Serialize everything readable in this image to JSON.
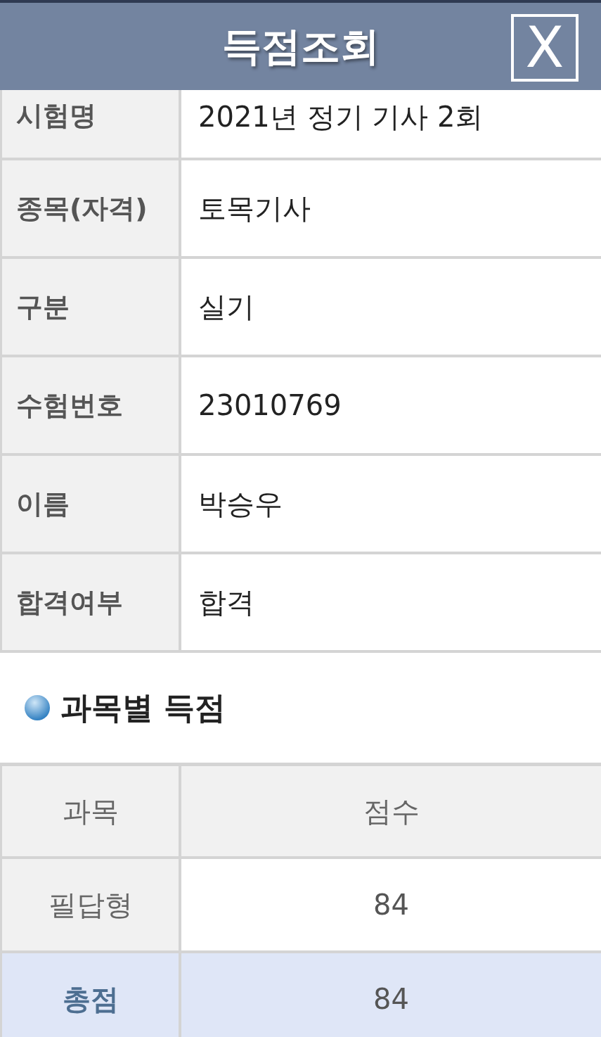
{
  "header": {
    "title": "득점조회",
    "close_label": "X"
  },
  "info_rows": [
    {
      "label": "시험명",
      "value": "2021년 정기 기사 2회"
    },
    {
      "label": "종목(자격)",
      "value": "토목기사"
    },
    {
      "label": "구분",
      "value": "실기"
    },
    {
      "label": "수험번호",
      "value": "23010769"
    },
    {
      "label": "이름",
      "value": "박승우"
    },
    {
      "label": "합격여부",
      "value": "합격"
    }
  ],
  "section_title": "과목별 득점",
  "score_table": {
    "columns": [
      "과목",
      "점수"
    ],
    "rows": [
      {
        "kind": "subject",
        "subject": "필답형",
        "score": "84"
      },
      {
        "kind": "total",
        "subject": "총점",
        "score": "84"
      }
    ]
  }
}
